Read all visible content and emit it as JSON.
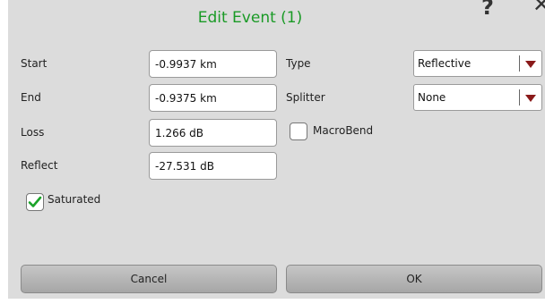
{
  "dialog": {
    "title": "Edit Event (1)",
    "help_glyph": "?",
    "close_glyph": "✕"
  },
  "fields": {
    "start": {
      "label": "Start",
      "value": "-0.9937 km"
    },
    "end": {
      "label": "End",
      "value": "-0.9375 km"
    },
    "loss": {
      "label": "Loss",
      "value": "1.266 dB"
    },
    "reflect": {
      "label": "Reflect",
      "value": "-27.531 dB"
    }
  },
  "type": {
    "label": "Type",
    "selected": "Reflective"
  },
  "splitter": {
    "label": "Splitter",
    "selected": "None"
  },
  "macrobend": {
    "label": "MacroBend",
    "checked": false
  },
  "saturated": {
    "label": "Saturated",
    "checked": true
  },
  "buttons": {
    "cancel": "Cancel",
    "ok": "OK"
  },
  "colors": {
    "title": "#1a9a26",
    "check": "#1aa329",
    "dropdown_arrow": "#8a1a1a",
    "background": "#dcdcdc"
  },
  "icons": [
    "help-icon",
    "close-icon",
    "chevron-down-icon",
    "checkmark-icon"
  ]
}
